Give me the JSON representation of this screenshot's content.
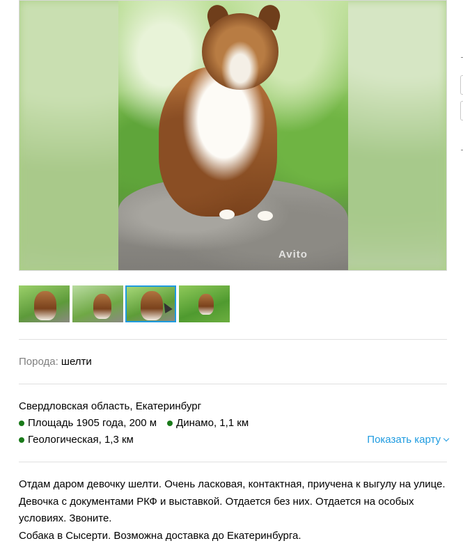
{
  "gallery": {
    "watermark": "Avito",
    "thumbnail_count": 4,
    "selected_thumbnail": 3
  },
  "params": {
    "breed_label": "Порода:",
    "breed_value": "шелти"
  },
  "location": {
    "address": "Свердловская область, Екатеринбург",
    "metro": [
      {
        "name": "Площадь 1905 года",
        "distance": "200 м"
      },
      {
        "name": "Динамо",
        "distance": "1,1 км"
      },
      {
        "name": "Геологическая",
        "distance": "1,3 км"
      }
    ],
    "show_map_label": "Показать карту"
  },
  "description": {
    "line1": "Отдам даром девочку шелти. Очень ласковая, контактная, приучена к выгулу на улице. Девочка с документами РКФ и выставкой. Отдается без них. Отдается на особых условиях. Звоните.",
    "line2": "Собака в Сысерти. Возможна доставка до Екатеринбурга."
  },
  "colors": {
    "metro_dot": "#1a7a1a",
    "link": "#1e9be0",
    "label_gray": "#7f7f7f",
    "selected_border": "#1e9be0"
  }
}
